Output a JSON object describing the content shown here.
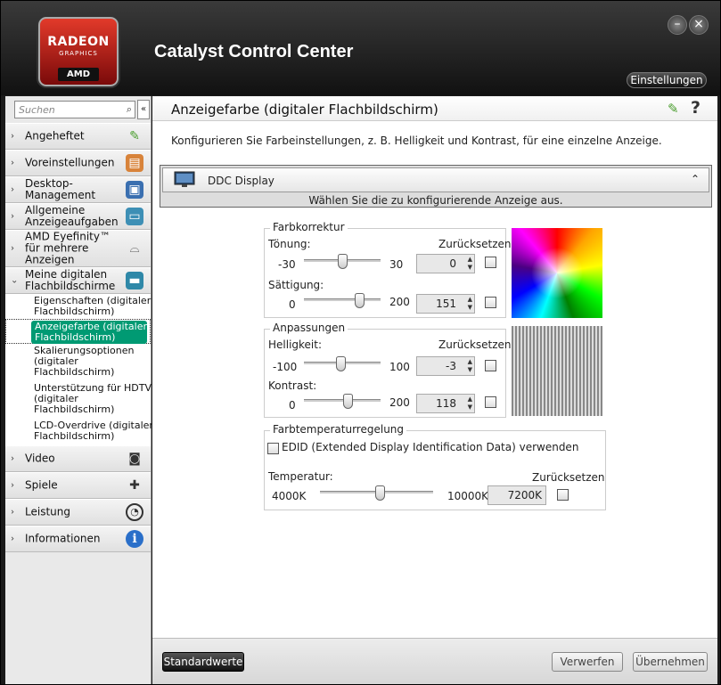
{
  "window": {
    "title": "Catalyst Control Center",
    "settings_label": "Einstellungen",
    "minimize_glyph": "–",
    "close_glyph": "×"
  },
  "logo": {
    "line1": "RADEON",
    "line2": "GRAPHICS",
    "line3": "AMD"
  },
  "sidebar": {
    "search_placeholder": "Suchen",
    "collapse_glyph": "«",
    "items": [
      {
        "label": "Angeheftet",
        "icon": "pin-icon"
      },
      {
        "label": "Voreinstellungen",
        "icon": "presets-icon"
      },
      {
        "label": "Desktop-\nManagement",
        "icon": "desktop-icon"
      },
      {
        "label": "Allgemeine\nAnzeigeaufgaben",
        "icon": "display-tasks-icon"
      },
      {
        "label": "AMD Eyefinity™\nfür mehrere\nAnzeigen",
        "icon": "eyefinity-icon"
      },
      {
        "label": "Meine digitalen\nFlachbildschirme",
        "icon": "flatpanel-icon"
      },
      {
        "label": "Video",
        "icon": "camera-icon"
      },
      {
        "label": "Spiele",
        "icon": "gamepad-icon"
      },
      {
        "label": "Leistung",
        "icon": "gauge-icon"
      },
      {
        "label": "Informationen",
        "icon": "info-icon"
      }
    ],
    "subitems": [
      {
        "label": "Eigenschaften (digitaler\nFlachbildschirm)"
      },
      {
        "label": "Anzeigefarbe (digitaler\nFlachbildschirm)"
      },
      {
        "label": "Skalierungsoptionen\n(digitaler\nFlachbildschirm)"
      },
      {
        "label": "Unterstützung für HDTV\n(digitaler\nFlachbildschirm)"
      },
      {
        "label": "LCD-Overdrive (digitaler\nFlachbildschirm)"
      }
    ]
  },
  "page": {
    "title": "Anzeigefarbe (digitaler Flachbildschirm)",
    "description": "Konfigurieren Sie Farbeinstellungen, z. B. Helligkeit und Kontrast, für eine einzelne Anzeige.",
    "display_name": "DDC Display",
    "display_hint": "Wählen Sie die zu konfigurierende Anzeige aus."
  },
  "farbkorrektur": {
    "title": "Farbkorrektur",
    "reset_label": "Zurücksetzen",
    "hue": {
      "label": "Tönung:",
      "min": "-30",
      "max": "30",
      "value": "0",
      "fraction": 0.5
    },
    "saturation": {
      "label": "Sättigung:",
      "min": "0",
      "max": "200",
      "value": "151",
      "fraction": 0.755
    }
  },
  "anpassungen": {
    "title": "Anpassungen",
    "reset_label": "Zurücksetzen",
    "brightness": {
      "label": "Helligkeit:",
      "min": "-100",
      "max": "100",
      "value": "-3",
      "fraction": 0.485
    },
    "contrast": {
      "label": "Kontrast:",
      "min": "0",
      "max": "200",
      "value": "118",
      "fraction": 0.59
    }
  },
  "farbtemperatur": {
    "title": "Farbtemperaturregelung",
    "edid_label": "EDID (Extended Display Identification Data) verwenden",
    "temp_label": "Temperatur:",
    "reset_label": "Zurücksetzen",
    "min": "4000K",
    "max": "10000K",
    "value": "7200K",
    "fraction": 0.533
  },
  "footer": {
    "defaults": "Standardwerte",
    "discard": "Verwerfen",
    "apply": "Übernehmen"
  },
  "colors": {
    "accent": "#009a73",
    "header_bg": "#1a1a1a",
    "logo_red": "#c8201a"
  }
}
